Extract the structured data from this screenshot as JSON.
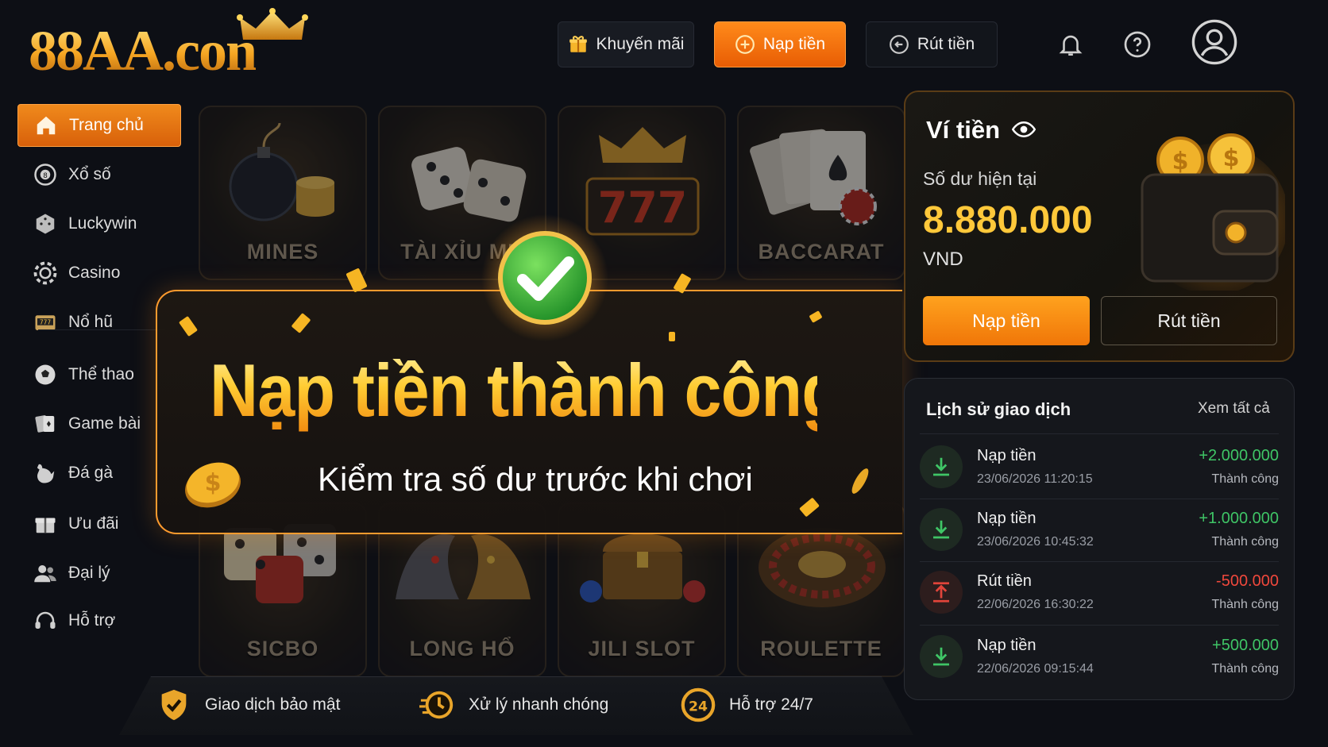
{
  "header": {
    "logo_text": "88AA.con",
    "promo_label": "Khuyến mãi",
    "deposit_label": "Nạp tiền",
    "withdraw_label": "Rút tiền"
  },
  "sidebar": {
    "items": [
      {
        "label": "Trang chủ",
        "icon": "home-icon",
        "active": true
      },
      {
        "label": "Xổ số",
        "icon": "lottery-ball-icon"
      },
      {
        "label": "Luckywin",
        "icon": "dice-icon"
      },
      {
        "label": "Casino",
        "icon": "casino-chip-icon"
      },
      {
        "label": "Nổ hũ",
        "icon": "slot-machine-icon"
      },
      {
        "label": "Thể thao",
        "icon": "soccer-ball-icon"
      },
      {
        "label": "Game bài",
        "icon": "playing-cards-icon"
      },
      {
        "label": "Đá gà",
        "icon": "rooster-icon"
      },
      {
        "label": "Ưu đãi",
        "icon": "gift-icon"
      },
      {
        "label": "Đại lý",
        "icon": "agents-icon"
      },
      {
        "label": "Hỗ trợ",
        "icon": "headset-icon"
      }
    ]
  },
  "games": {
    "top": [
      "MINES",
      "TÀI XỈU MD",
      "777",
      "BACCARAT"
    ],
    "bottom": [
      "SICBO",
      "LONG HỔ",
      "JILI SLOT",
      "ROULETTE"
    ]
  },
  "banner": {
    "title": "Nạp tiền thành công",
    "subtitle": "Kiểm tra số dư trước khi chơi"
  },
  "wallet": {
    "title": "Ví tiền",
    "balance_label": "Số dư hiện tại",
    "balance": "8.880.000",
    "currency": "VND",
    "deposit_label": "Nạp tiền",
    "withdraw_label": "Rút tiền"
  },
  "history": {
    "title": "Lịch sử giao dịch",
    "view_all": "Xem tất cả",
    "rows": [
      {
        "type": "Nạp tiền",
        "datetime": "23/06/2026 11:20:15",
        "amount": "+2.000.000",
        "status": "Thành công",
        "dir": "in"
      },
      {
        "type": "Nạp tiền",
        "datetime": "23/06/2026 10:45:32",
        "amount": "+1.000.000",
        "status": "Thành công",
        "dir": "in"
      },
      {
        "type": "Rút tiền",
        "datetime": "22/06/2026 16:30:22",
        "amount": "-500.000",
        "status": "Thành công",
        "dir": "out"
      },
      {
        "type": "Nạp tiền",
        "datetime": "22/06/2026 09:15:44",
        "amount": "+500.000",
        "status": "Thành công",
        "dir": "in"
      }
    ]
  },
  "footer": {
    "features": [
      "Giao dịch bảo mật",
      "Xử lý nhanh chóng",
      "Hỗ trợ 24/7"
    ],
    "support_badge": "24"
  },
  "colors": {
    "accent": "#f07608",
    "gold": "#ffc83a",
    "positive": "#3fc566",
    "negative": "#f0483c"
  }
}
